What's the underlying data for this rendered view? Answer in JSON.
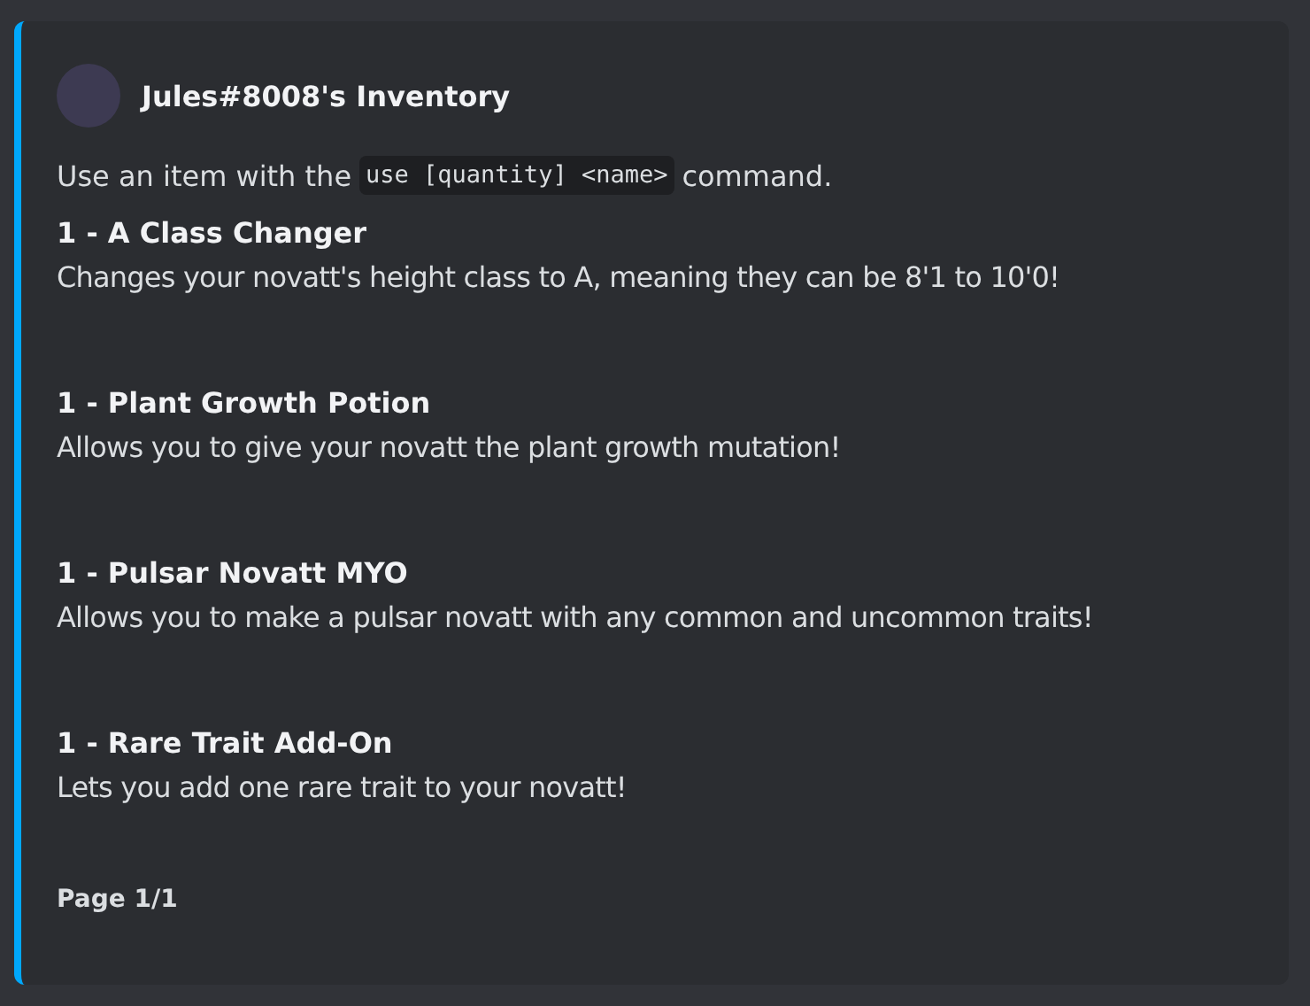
{
  "embed": {
    "color": "#00a8fc",
    "title": "Jules#8008's Inventory",
    "description": {
      "before": "Use an item with the",
      "code": "use [quantity] <name>",
      "after": "command."
    },
    "items": [
      {
        "name": "1 - A Class Changer",
        "text": "Changes your novatt's height class to A, meaning they can be 8'1 to 10'0!"
      },
      {
        "name": "1 - Plant Growth Potion",
        "text": "Allows you to give your novatt the plant growth mutation!"
      },
      {
        "name": "1 - Pulsar Novatt MYO",
        "text": "Allows you to make a pulsar novatt with any common and uncommon traits!"
      },
      {
        "name": "1 - Rare Trait Add-On",
        "text": "Lets you add one rare trait to your novatt!"
      }
    ],
    "footer": "Page 1/1"
  }
}
